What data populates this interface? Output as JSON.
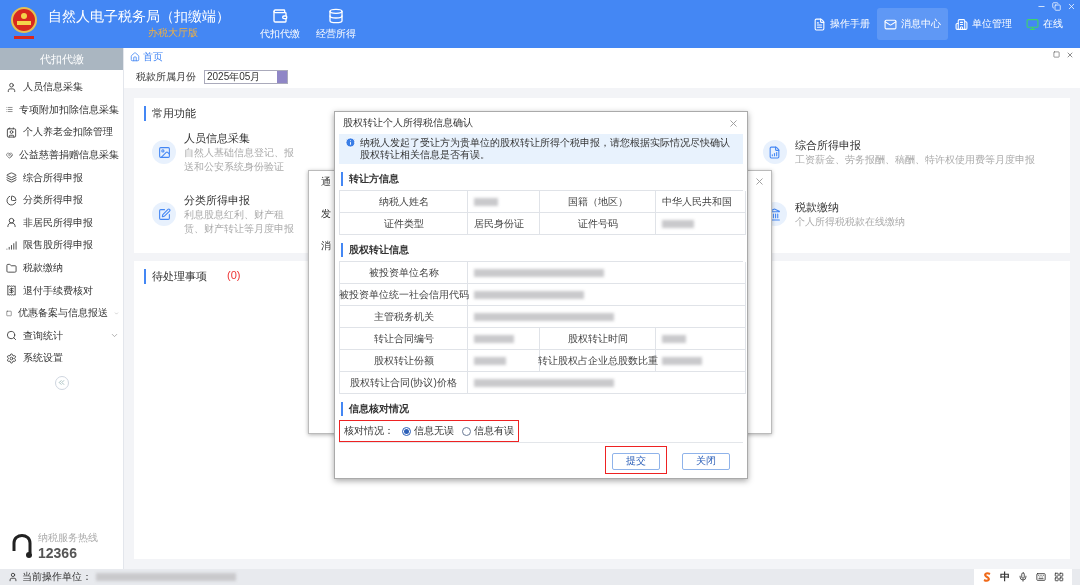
{
  "window": {
    "title": "自然人电子税务局（扣缴端）",
    "subtitle": "办税大厅版"
  },
  "top_nav": [
    {
      "label": "代扣代缴"
    },
    {
      "label": "经营所得"
    }
  ],
  "header_actions": [
    {
      "label": "操作手册",
      "selected": false
    },
    {
      "label": "消息中心",
      "selected": true
    },
    {
      "label": "单位管理",
      "selected": false
    },
    {
      "label": "在线",
      "selected": false
    }
  ],
  "sidebar": {
    "title": "代扣代缴",
    "items": [
      {
        "label": "人员信息采集",
        "expandable": false
      },
      {
        "label": "专项附加扣除信息采集",
        "expandable": false
      },
      {
        "label": "个人养老金扣除管理",
        "expandable": false
      },
      {
        "label": "公益慈善捐赠信息采集",
        "expandable": false
      },
      {
        "label": "综合所得申报",
        "expandable": false
      },
      {
        "label": "分类所得申报",
        "expandable": false
      },
      {
        "label": "非居民所得申报",
        "expandable": false
      },
      {
        "label": "限售股所得申报",
        "expandable": false
      },
      {
        "label": "税款缴纳",
        "expandable": false
      },
      {
        "label": "退付手续费核对",
        "expandable": false
      },
      {
        "label": "优惠备案与信息报送",
        "expandable": true
      },
      {
        "label": "查询统计",
        "expandable": true
      },
      {
        "label": "系统设置",
        "expandable": false
      }
    ],
    "hotline": {
      "caption": "纳税服务热线",
      "number": "12366"
    }
  },
  "breadcrumb": "首页",
  "month_filter": {
    "label": "税款所属月份",
    "value": "2025年05月"
  },
  "common_functions": {
    "title": "常用功能",
    "items": [
      {
        "title": "人员信息采集",
        "description": "自然人基础信息登记、报送和公安系统身份验证"
      },
      {
        "title": "综合所得申报",
        "description": "工资薪金、劳务报酬、稿酬、特许权使用费等月度申报"
      },
      {
        "title": "分类所得申报",
        "description": "利息股息红利、财产租赁、财产转让等月度申报"
      },
      {
        "title": "税款缴纳",
        "description": "个人所得税税款在线缴纳"
      }
    ]
  },
  "pending": {
    "title": "待处理事项",
    "count": "(0)"
  },
  "background_dialog": {
    "title": "通",
    "labels": [
      "发",
      "消"
    ]
  },
  "dialog": {
    "title": "股权转让个人所得税信息确认",
    "notice": "纳税人发起了受让方为贵单位的股权转让所得个税申报，请您根据实际情况尽快确认股权转让相关信息是否有误。",
    "sections": [
      {
        "title": "转让方信息",
        "rows": [
          [
            {
              "kind": "label",
              "text": "纳税人姓名"
            },
            {
              "kind": "redacted"
            },
            {
              "kind": "label",
              "text": "国籍（地区）"
            },
            {
              "kind": "value",
              "text": "中华人民共和国"
            }
          ],
          [
            {
              "kind": "label",
              "text": "证件类型"
            },
            {
              "kind": "value",
              "text": "居民身份证"
            },
            {
              "kind": "label",
              "text": "证件号码"
            },
            {
              "kind": "redacted"
            }
          ]
        ]
      },
      {
        "title": "股权转让信息",
        "rows": [
          [
            {
              "kind": "label",
              "text": "被投资单位名称"
            },
            {
              "kind": "redacted"
            }
          ],
          [
            {
              "kind": "label",
              "text": "被投资单位统一社会信用代码"
            },
            {
              "kind": "redacted"
            }
          ],
          [
            {
              "kind": "label",
              "text": "主管税务机关"
            },
            {
              "kind": "redacted"
            }
          ],
          [
            {
              "kind": "label",
              "text": "转让合同编号"
            },
            {
              "kind": "redacted"
            },
            {
              "kind": "label",
              "text": "股权转让时间"
            },
            {
              "kind": "redacted"
            }
          ],
          [
            {
              "kind": "label",
              "text": "股权转让份额"
            },
            {
              "kind": "redacted"
            },
            {
              "kind": "label",
              "text": "转让股权占企业总股数比重"
            },
            {
              "kind": "redacted"
            }
          ],
          [
            {
              "kind": "label",
              "text": "股权转让合同(协议)价格"
            },
            {
              "kind": "redacted"
            }
          ]
        ]
      }
    ],
    "verification": {
      "title": "信息核对情况",
      "label": "核对情况：",
      "highlighted": true,
      "options": [
        {
          "label": "信息无误",
          "selected": true
        },
        {
          "label": "信息有误",
          "selected": false
        }
      ]
    },
    "buttons": [
      {
        "label": "提交",
        "highlighted": true
      },
      {
        "label": "关闭",
        "highlighted": false
      }
    ]
  },
  "status_bar": {
    "label": "当前操作单位：",
    "redacted": true,
    "ime": "中"
  }
}
